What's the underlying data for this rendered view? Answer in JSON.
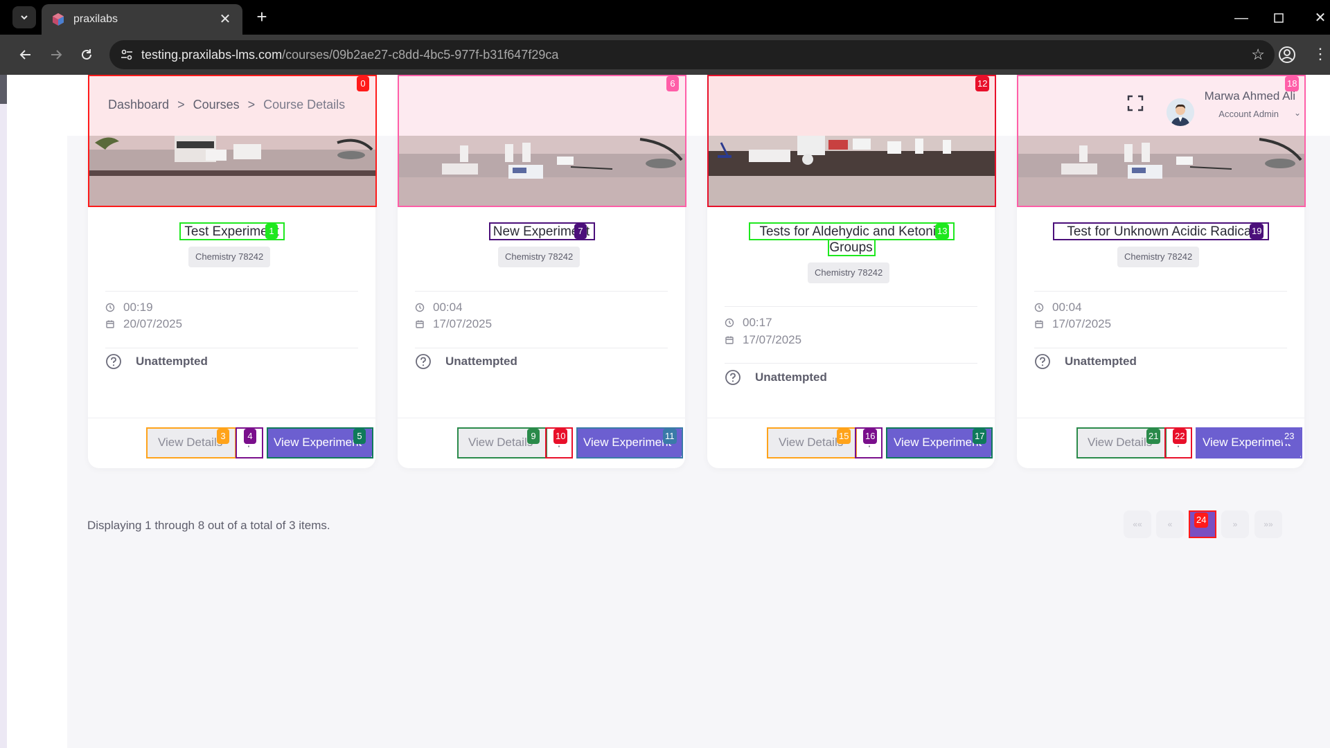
{
  "browser": {
    "tab_title": "praxilabs",
    "url_host": "testing.praxilabs-lms.com",
    "url_path": "/courses/09b2ae27-c8dd-4bc5-977f-b31f647f29ca"
  },
  "header": {
    "breadcrumb": [
      "Dashboard",
      ">",
      "Courses",
      ">",
      "Course Details"
    ],
    "user_name": "Marwa Ahmed Ali",
    "user_role": "Account Admin"
  },
  "cards": [
    {
      "title": "Test Experiment",
      "badge": "Chemistry 78242",
      "duration": "00:19",
      "date": "20/07/2025",
      "status": "Unattempted",
      "details_label": "View Details",
      "view_label": "View Experiment"
    },
    {
      "title": "New Experiment",
      "badge": "Chemistry 78242",
      "duration": "00:04",
      "date": "17/07/2025",
      "status": "Unattempted",
      "details_label": "View Details",
      "view_label": "View Experiment"
    },
    {
      "title_line1": "Tests for Aldehydic and Ketonic",
      "title_line2": "Groups",
      "badge": "Chemistry 78242",
      "duration": "00:17",
      "date": "17/07/2025",
      "status": "Unattempted",
      "details_label": "View Details",
      "view_label": "View Experiment"
    },
    {
      "title": "Test for Unknown Acidic Radical",
      "badge": "Chemistry 78242",
      "duration": "00:04",
      "date": "17/07/2025",
      "status": "Unattempted",
      "details_label": "View Details",
      "view_label": "View Experiment"
    }
  ],
  "pagination": {
    "summary": "Displaying 1 through 8 out of a total of 3 items.",
    "first": "««",
    "prev": "«",
    "next": "»",
    "last": "»»"
  },
  "marks": [
    "0",
    "1",
    "3",
    "4",
    "5",
    "6",
    "7",
    "9",
    "10",
    "11",
    "12",
    "13",
    "15",
    "16",
    "17",
    "18",
    "19",
    "21",
    "22",
    "23",
    "24"
  ],
  "colors": {
    "accent": "#6c5fd0",
    "page_bg": "#f6f6f9",
    "image_bg": "#fde7ea"
  }
}
